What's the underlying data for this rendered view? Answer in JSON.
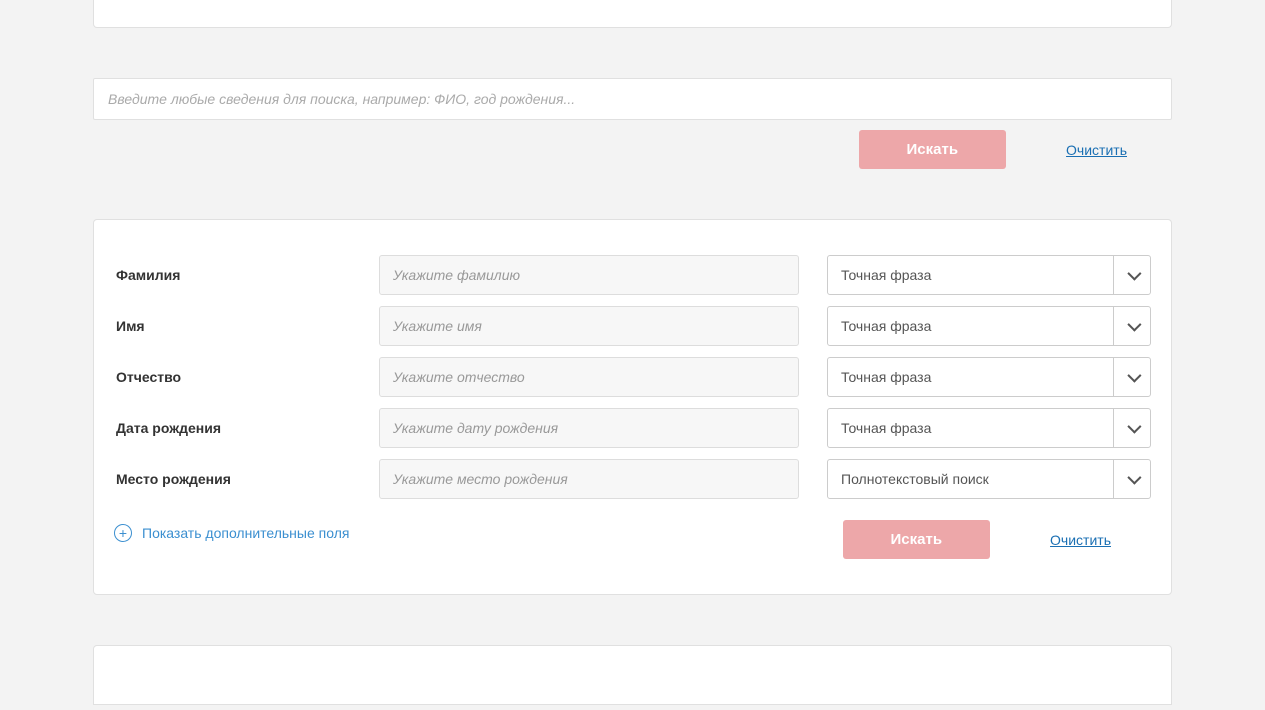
{
  "simpleSearch": {
    "placeholder": "Введите любые сведения для поиска, например: ФИО, год рождения...",
    "searchButton": "Искать",
    "clearLink": "Очистить"
  },
  "advForm": {
    "fields": [
      {
        "label": "Фамилия",
        "placeholder": "Укажите фамилию",
        "selectValue": "Точная фраза"
      },
      {
        "label": "Имя",
        "placeholder": "Укажите имя",
        "selectValue": "Точная фраза"
      },
      {
        "label": "Отчество",
        "placeholder": "Укажите отчество",
        "selectValue": "Точная фраза"
      },
      {
        "label": "Дата рождения",
        "placeholder": "Укажите дату рождения",
        "selectValue": "Точная фраза"
      },
      {
        "label": "Место рождения",
        "placeholder": "Укажите место рождения",
        "selectValue": "Полнотекстовый поиск"
      }
    ],
    "showMore": "Показать дополнительные поля",
    "searchButton": "Искать",
    "clearLink": "Очистить"
  }
}
